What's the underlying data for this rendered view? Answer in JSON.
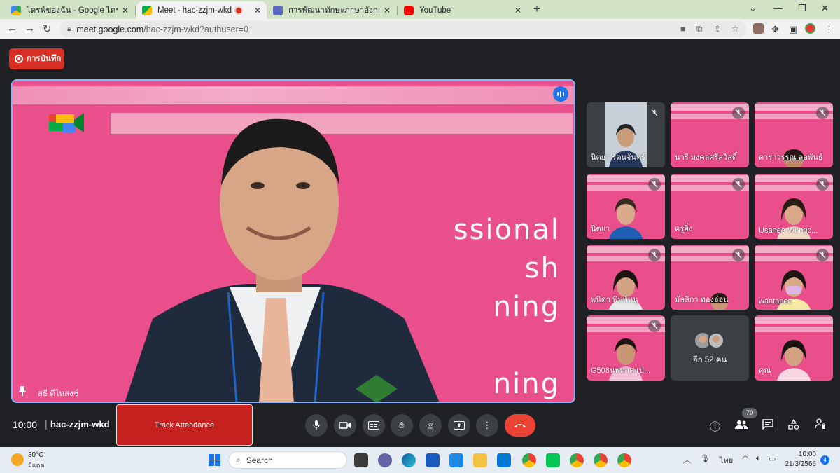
{
  "browser": {
    "tabs": [
      {
        "title": "ไดรฟ์ของฉัน - Google ไดรฟ์",
        "active": false
      },
      {
        "title": "Meet - hac-zzjm-wkd",
        "active": true
      },
      {
        "title": "การพัฒนาทักษะภาษาอังกฤษ English",
        "active": false
      },
      {
        "title": "YouTube",
        "active": false
      }
    ],
    "url_host": "meet.google.com",
    "url_path": "/hac-zzjm-wkd?authuser=0"
  },
  "meet": {
    "record_label": "การบันทึก",
    "main_speaker": "สธี ดีไทสงช์",
    "slide_text": "ssional",
    "slide_text2": "sh",
    "slide_text3": "ning",
    "slide_text4": "ning",
    "participants": [
      {
        "name": "นิตยา รัตนจันทร์"
      },
      {
        "name": "นารี มงคลศรีสวัสดิ์"
      },
      {
        "name": "ดาราวรรณ ลอพันธ์"
      },
      {
        "name": "นิตยา"
      },
      {
        "name": "ครูอิ๋ง"
      },
      {
        "name": "Usanee Wongc..."
      },
      {
        "name": "พนิดา พิมพ์หนู"
      },
      {
        "name": "มัลลิกา ทองอ่อน"
      },
      {
        "name": "wantanee"
      },
      {
        "name": "G508นพมาศ เป..."
      },
      {
        "name": "อีก 52 คน"
      },
      {
        "name": "คุณ"
      }
    ],
    "time": "10:00",
    "separator": "|",
    "meeting_code": "hac-zzjm-wkd",
    "track_attendance": "Track Attendance",
    "participant_count": "70"
  },
  "taskbar": {
    "temperature": "30°C",
    "condition": "มีแดด",
    "search_placeholder": "Search",
    "language": "ไทย",
    "time": "10:00",
    "date": "21/3/2566",
    "notification_count": "4"
  },
  "colors": {
    "meet_bg": "#202124",
    "slide_pink": "#e94f8a",
    "record_red": "#d93025",
    "end_call_red": "#ea4335",
    "active_border": "#8ab4f8"
  }
}
